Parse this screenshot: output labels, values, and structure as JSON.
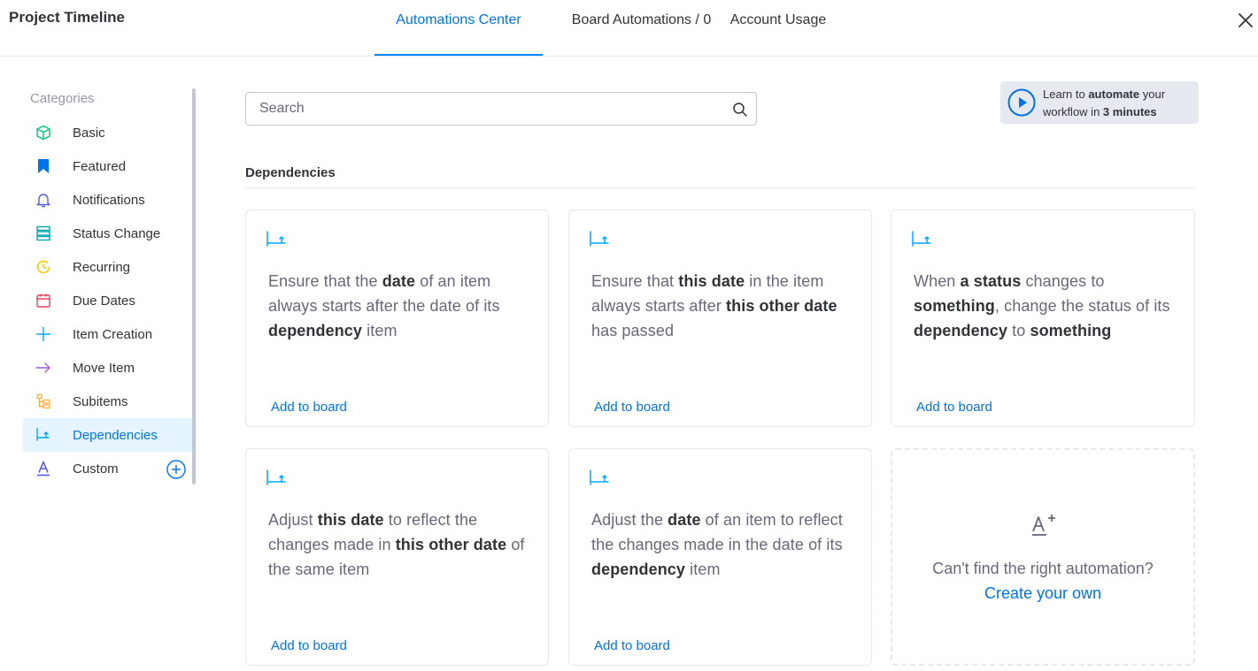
{
  "header": {
    "board_title": "Project Timeline",
    "tabs": [
      {
        "label": "Automations Center",
        "active": true
      },
      {
        "label": "Board Automations / 0",
        "active": false
      },
      {
        "label": "Account Usage",
        "active": false
      }
    ]
  },
  "sidebar": {
    "heading": "Categories",
    "items": [
      {
        "label": "Basic",
        "icon": "cube-icon",
        "color": "#00c875"
      },
      {
        "label": "Featured",
        "icon": "bookmark-icon",
        "color": "#0073ea"
      },
      {
        "label": "Notifications",
        "icon": "bell-icon",
        "color": "#5559df"
      },
      {
        "label": "Status Change",
        "icon": "status-list-icon",
        "color": "#00a9a9"
      },
      {
        "label": "Recurring",
        "icon": "clock-icon",
        "color": "#ffcb00"
      },
      {
        "label": "Due Dates",
        "icon": "calendar-icon",
        "color": "#e2445c"
      },
      {
        "label": "Item Creation",
        "icon": "plus-icon",
        "color": "#00a9ff"
      },
      {
        "label": "Move Item",
        "icon": "arrow-right-icon",
        "color": "#a25ddc"
      },
      {
        "label": "Subitems",
        "icon": "subitems-icon",
        "color": "#fdab3d"
      },
      {
        "label": "Dependencies",
        "icon": "dependency-icon",
        "color": "#00a9ff",
        "active": true
      },
      {
        "label": "Custom",
        "icon": "custom-font-icon",
        "color": "#5559df"
      }
    ]
  },
  "search": {
    "placeholder": "Search",
    "value": ""
  },
  "learn": {
    "prefix": "Learn to ",
    "bold1": "automate",
    "mid": " your workflow in ",
    "bold2": "3 minutes"
  },
  "section": {
    "title": "Dependencies"
  },
  "cards": [
    {
      "segments": [
        {
          "t": "Ensure that the ",
          "b": false
        },
        {
          "t": "date",
          "b": true
        },
        {
          "t": " of an item always starts after the date of its ",
          "b": false
        },
        {
          "t": "dependency",
          "b": true
        },
        {
          "t": " item",
          "b": false
        }
      ],
      "action": "Add to board"
    },
    {
      "segments": [
        {
          "t": "Ensure that ",
          "b": false
        },
        {
          "t": "this date",
          "b": true
        },
        {
          "t": " in the item always starts after ",
          "b": false
        },
        {
          "t": "this other date",
          "b": true
        },
        {
          "t": " has passed",
          "b": false
        }
      ],
      "action": "Add to board"
    },
    {
      "segments": [
        {
          "t": "When ",
          "b": false
        },
        {
          "t": "a status",
          "b": true
        },
        {
          "t": " changes to ",
          "b": false
        },
        {
          "t": "something",
          "b": true
        },
        {
          "t": ", change the status of its ",
          "b": false
        },
        {
          "t": "dependency",
          "b": true
        },
        {
          "t": " to ",
          "b": false
        },
        {
          "t": "something",
          "b": true
        }
      ],
      "action": "Add to board"
    },
    {
      "segments": [
        {
          "t": "Adjust ",
          "b": false
        },
        {
          "t": "this date",
          "b": true
        },
        {
          "t": " to reflect the changes made in ",
          "b": false
        },
        {
          "t": "this other date",
          "b": true
        },
        {
          "t": " of the same item",
          "b": false
        }
      ],
      "action": "Add to board"
    },
    {
      "segments": [
        {
          "t": "Adjust the ",
          "b": false
        },
        {
          "t": "date",
          "b": true
        },
        {
          "t": " of an item to reflect the changes made in the date of its ",
          "b": false
        },
        {
          "t": "dependency",
          "b": true
        },
        {
          "t": " item",
          "b": false
        }
      ],
      "action": "Add to board"
    }
  ],
  "create_card": {
    "prompt": "Can't find the right automation?",
    "link": "Create your own"
  },
  "colors": {
    "accent": "#0073ea",
    "dependency_icon": "#00a9ff"
  }
}
